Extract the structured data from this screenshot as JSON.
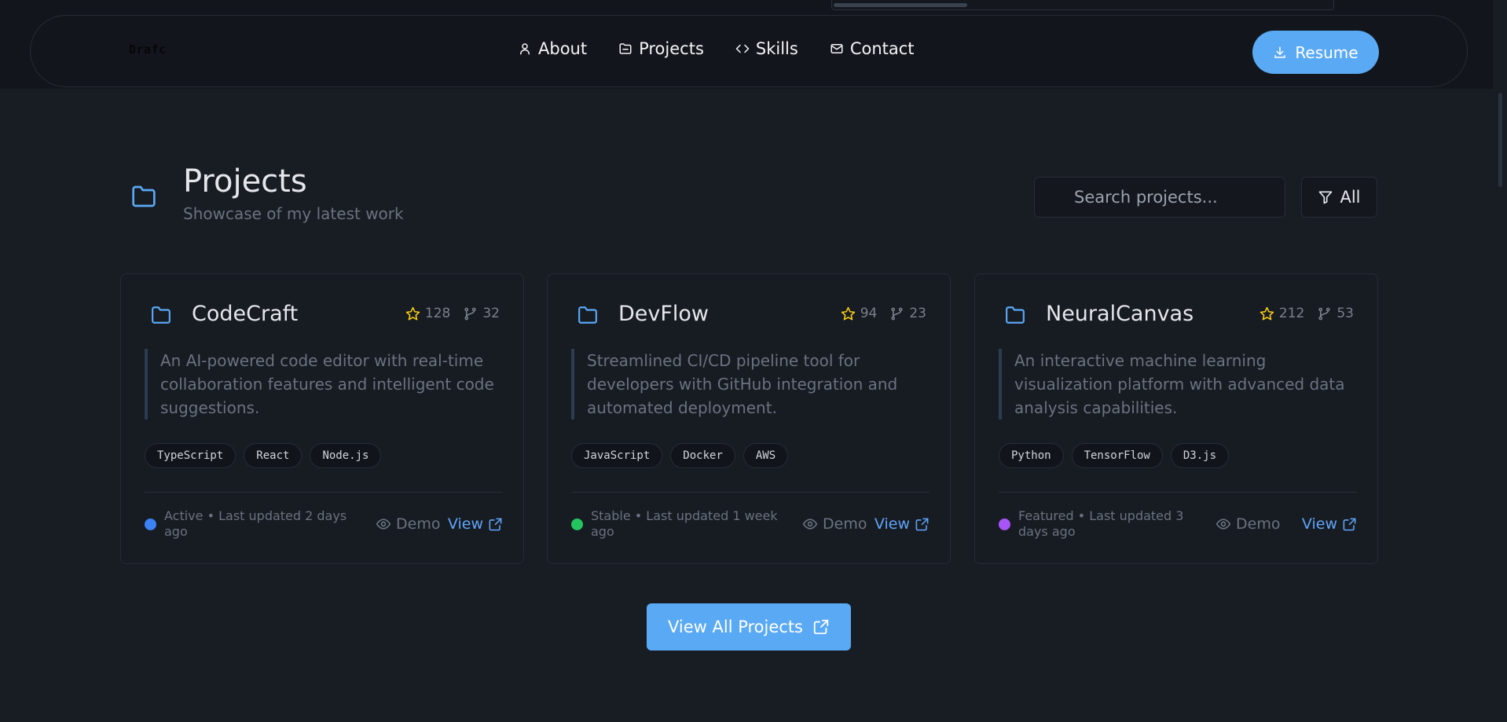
{
  "nav": {
    "logo": "Drafc",
    "links": [
      {
        "label": "About",
        "icon": "user-icon"
      },
      {
        "label": "Projects",
        "icon": "folder-icon"
      },
      {
        "label": "Skills",
        "icon": "code-icon"
      },
      {
        "label": "Contact",
        "icon": "mail-icon"
      }
    ],
    "resume_label": "Resume"
  },
  "section": {
    "title": "Projects",
    "subtitle": "Showcase of my latest work",
    "search_placeholder": "Search projects...",
    "filter_label": "All"
  },
  "projects": [
    {
      "name": "CodeCraft",
      "stars": "128",
      "forks": "32",
      "description": "An AI-powered code editor with real-time collaboration features and intelligent code suggestions.",
      "tags": [
        "TypeScript",
        "React",
        "Node.js"
      ],
      "status_color": "#3b82f6",
      "status_text": "Active • Last updated 2 days ago",
      "demo_label": "Demo",
      "view_label": "View"
    },
    {
      "name": "DevFlow",
      "stars": "94",
      "forks": "23",
      "description": "Streamlined CI/CD pipeline tool for developers with GitHub integration and automated deployment.",
      "tags": [
        "JavaScript",
        "Docker",
        "AWS"
      ],
      "status_color": "#22c55e",
      "status_text": "Stable • Last updated 1 week ago",
      "demo_label": "Demo",
      "view_label": "View"
    },
    {
      "name": "NeuralCanvas",
      "stars": "212",
      "forks": "53",
      "description": "An interactive machine learning visualization platform with advanced data analysis capabilities.",
      "tags": [
        "Python",
        "TensorFlow",
        "D3.js"
      ],
      "status_color": "#a855f7",
      "status_text": "Featured • Last updated 3 days ago",
      "demo_label": "Demo",
      "view_label": "View"
    }
  ],
  "view_all_label": "View All Projects",
  "colors": {
    "accent": "#5aa9f5",
    "link": "#60a5fa",
    "star": "#facc15",
    "background": "#181c23"
  }
}
